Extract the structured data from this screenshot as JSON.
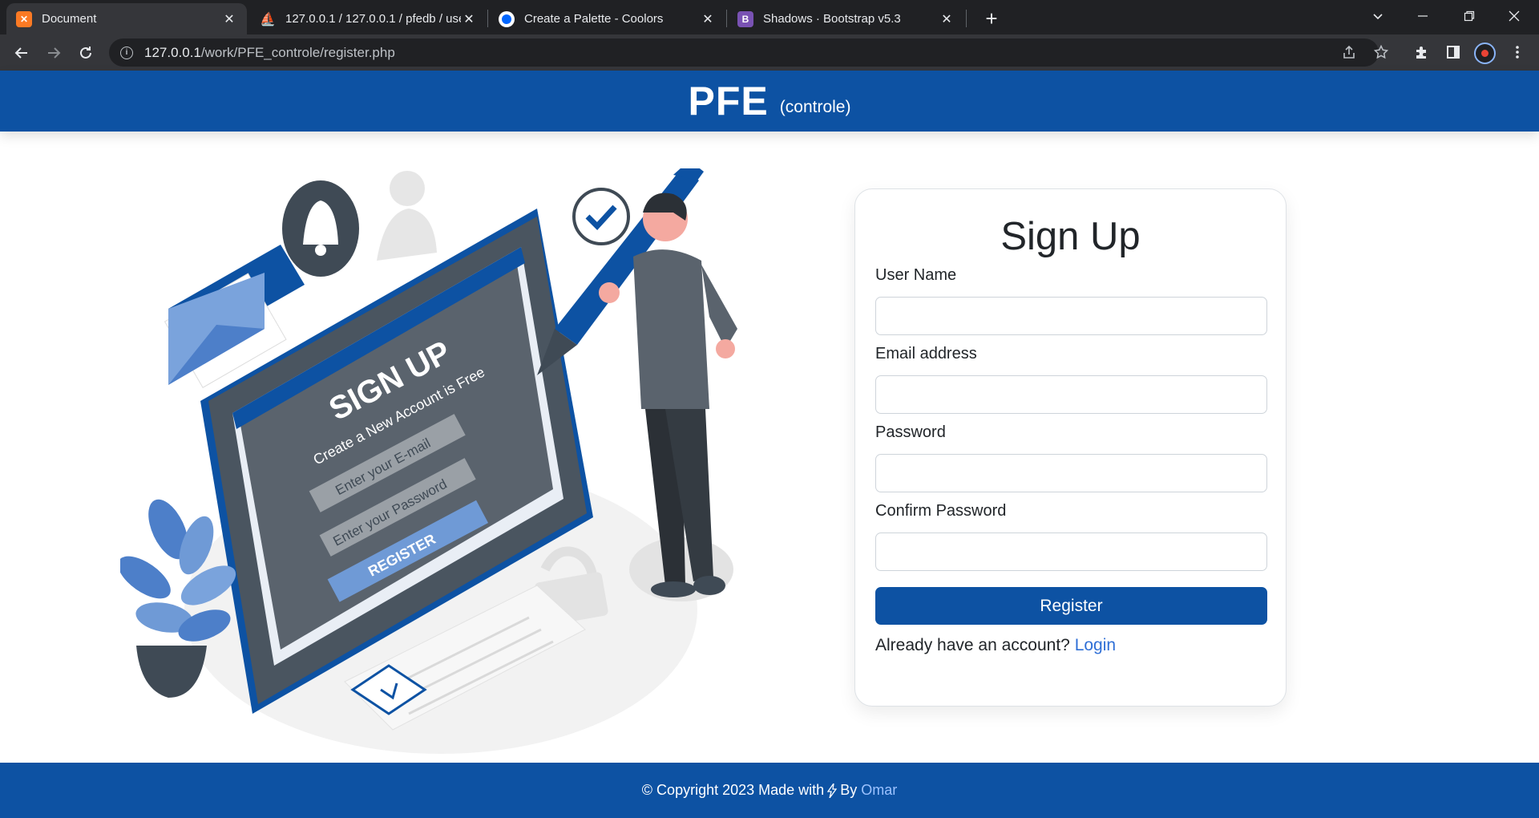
{
  "browser": {
    "tabs": [
      {
        "title": "Document",
        "favicon": "xampp-icon",
        "active": true
      },
      {
        "title": "127.0.0.1 / 127.0.0.1 / pfedb / use",
        "favicon": "phpmyadmin-icon",
        "active": false
      },
      {
        "title": "Create a Palette - Coolors",
        "favicon": "coolors-icon",
        "active": false
      },
      {
        "title": "Shadows · Bootstrap v5.3",
        "favicon": "bootstrap-icon",
        "active": false
      }
    ],
    "url_host": "127.0.0.1",
    "url_path": "/work/PFE_controle/register.php"
  },
  "header": {
    "brand": "PFE",
    "brand_sub": "(controle)"
  },
  "illustration": {
    "heading": "SIGN UP",
    "subheading": "Create a New Account is Free",
    "email_placeholder": "Enter your E-mail",
    "password_placeholder": "Enter your Password",
    "button": "REGISTER"
  },
  "form": {
    "title": "Sign Up",
    "username_label": "User Name",
    "email_label": "Email address",
    "password_label": "Password",
    "confirm_label": "Confirm Password",
    "register_button": "Register",
    "login_prompt": "Already have an account?",
    "login_link": "Login"
  },
  "footer": {
    "text": "© Copyright 2023 Made with",
    "by": "By",
    "author": "Omar"
  },
  "colors": {
    "primary": "#0d52a3",
    "link": "#2f6fd6",
    "chrome_dark": "#202124",
    "chrome_tab": "#35363a"
  }
}
